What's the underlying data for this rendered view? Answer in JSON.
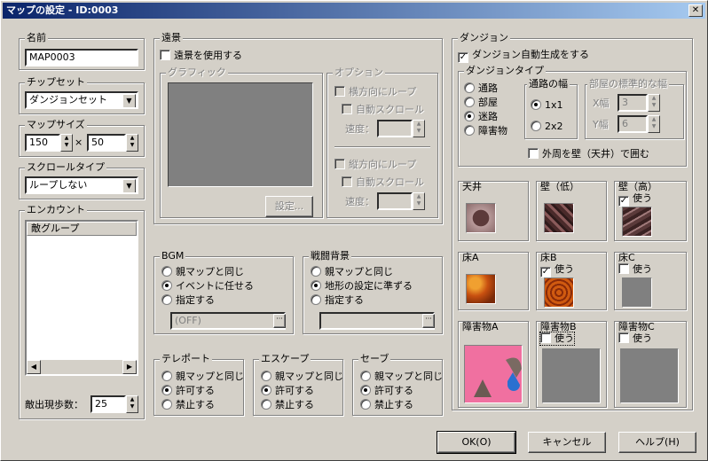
{
  "window": {
    "title": "マップの設定 - ID:0003",
    "close": "✕"
  },
  "name": {
    "label": "名前",
    "value": "MAP0003"
  },
  "chipset": {
    "label": "チップセット",
    "value": "ダンジョンセット"
  },
  "mapsize": {
    "label": "マップサイズ",
    "width": "150",
    "x": "×",
    "height": "50"
  },
  "scroll": {
    "label": "スクロールタイプ",
    "value": "ループしない"
  },
  "encounter": {
    "label": "エンカウント",
    "header": "敵グループ",
    "steps_label": "敵出現歩数：",
    "steps": "25"
  },
  "parallax": {
    "label": "遠景",
    "use": "遠景を使用する",
    "graphic": "グラフィック",
    "set": "設定...",
    "options": "オプション",
    "hloop": "横方向にループ",
    "autoscroll": "自動スクロール",
    "speed": "速度：",
    "vloop": "縦方向にループ",
    "autoscroll2": "自動スクロール",
    "speed2": "速度："
  },
  "bgm": {
    "label": "BGM",
    "opt1": "親マップと同じ",
    "opt2": "イベントに任せる",
    "opt3": "指定する",
    "value": "(OFF)"
  },
  "battle_bg": {
    "label": "戦闘背景",
    "opt1": "親マップと同じ",
    "opt2": "地形の設定に準ずる",
    "opt3": "指定する"
  },
  "teleport": {
    "label": "テレポート",
    "opt1": "親マップと同じ",
    "opt2": "許可する",
    "opt3": "禁止する"
  },
  "escape": {
    "label": "エスケープ",
    "opt1": "親マップと同じ",
    "opt2": "許可する",
    "opt3": "禁止する"
  },
  "save": {
    "label": "セーブ",
    "opt1": "親マップと同じ",
    "opt2": "許可する",
    "opt3": "禁止する"
  },
  "dungeon": {
    "label": "ダンジョン",
    "auto": "ダンジョン自動生成をする",
    "type_label": "ダンジョンタイプ",
    "t1": "通路",
    "t2": "部屋",
    "t3": "迷路",
    "t4": "障害物",
    "width_label": "通路の幅",
    "w1": "1x1",
    "w2": "2x2",
    "room_label": "部屋の標準的な幅",
    "xw": "X幅",
    "xv": "3",
    "yw": "Y幅",
    "yv": "6",
    "surround": "外周を壁（天井）で囲む"
  },
  "tiles": {
    "ceiling": "天井",
    "wall_low": "壁（低）",
    "wall_high": "壁（高）",
    "use1": "使う",
    "floor_a": "床A",
    "floor_b": "床B",
    "use2": "使う",
    "floor_c": "床C",
    "use3": "使う",
    "obs_a": "障害物A",
    "obs_b": "障害物B",
    "use4": "使う",
    "obs_c": "障害物C",
    "use5": "使う"
  },
  "buttons": {
    "ok": "OK(O)",
    "cancel": "キャンセル",
    "help": "ヘルプ(H)"
  }
}
